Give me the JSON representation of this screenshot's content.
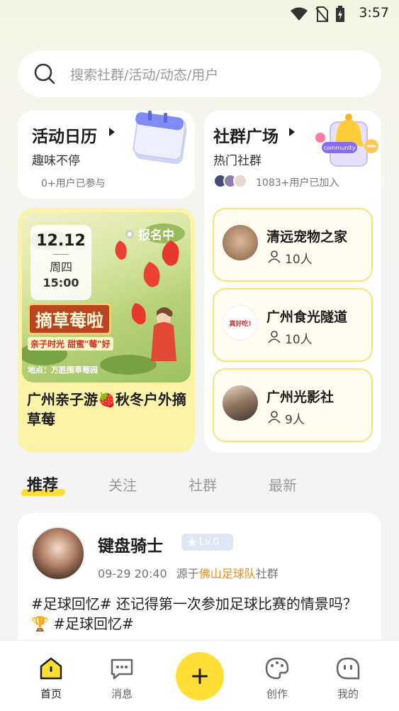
{
  "status_bar": {
    "time": "3:57"
  },
  "search": {
    "placeholder": "搜索社群/活动/动态/用户"
  },
  "calendar_card": {
    "title": "活动日历",
    "subtitle": "趣味不停",
    "participants": "0+用户已参与"
  },
  "community_card": {
    "title": "社群广场",
    "subtitle": "热门社群",
    "joined": "1083+用户已加入",
    "badge_text": "community",
    "groups": [
      {
        "name": "清远宠物之家",
        "count": "10人"
      },
      {
        "name": "广州食光隧道",
        "count": "10人",
        "avatar_text": "真好吃!"
      },
      {
        "name": "广州光影社",
        "count": "9人"
      }
    ]
  },
  "event_card": {
    "date": "12.12",
    "weekday": "周四",
    "time": "15:00",
    "status": "报名中",
    "poster_title": "摘草莓啦",
    "poster_slogan": "亲子时光 甜蜜\"莓\"好",
    "poster_location": "地点：万胜围草莓园",
    "title": "广州亲子游🍓秋冬户外摘草莓"
  },
  "tabs": [
    "推荐",
    "关注",
    "社群",
    "最新"
  ],
  "post": {
    "username": "键盘骑士",
    "level": "Lv.0",
    "time": "09-29 20:40",
    "source_prefix": "源于",
    "source_name": "佛山足球队",
    "source_suffix": "社群",
    "body": "#足球回忆# 还记得第一次参加足球比赛的情景吗？🏆 #足球回忆#"
  },
  "bottom_nav": [
    {
      "label": "首页",
      "icon": "home-icon"
    },
    {
      "label": "消息",
      "icon": "message-icon"
    },
    {
      "label": "创作",
      "icon": "palette-icon"
    },
    {
      "label": "我的",
      "icon": "profile-icon"
    }
  ],
  "colors": {
    "accent_yellow": "#ffdf35",
    "highlight_orange": "#f08a1d"
  }
}
